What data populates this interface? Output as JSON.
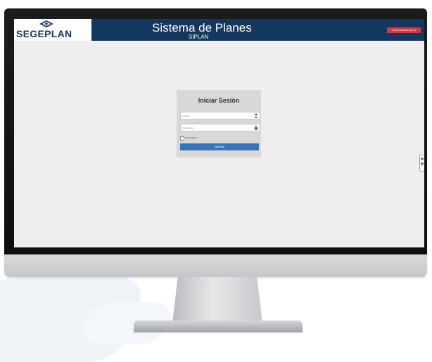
{
  "brand": {
    "logo_text": "SEGEPLAN"
  },
  "header": {
    "title": "Sistema de Planes",
    "subtitle": "SIPLAN",
    "login_button": "INICIAR SESIÓN SIPLAN"
  },
  "login": {
    "title": "Iniciar Sesión",
    "username_placeholder": "Usuario",
    "password_placeholder": "Contraseña",
    "remember_label": "Recordarme",
    "submit_label": "Ingresar"
  },
  "icons": {
    "user": "user-icon",
    "lock": "lock-icon"
  },
  "colors": {
    "header_bg": "#13375e",
    "login_button": "#d9363e",
    "submit_button": "#3474bd"
  }
}
